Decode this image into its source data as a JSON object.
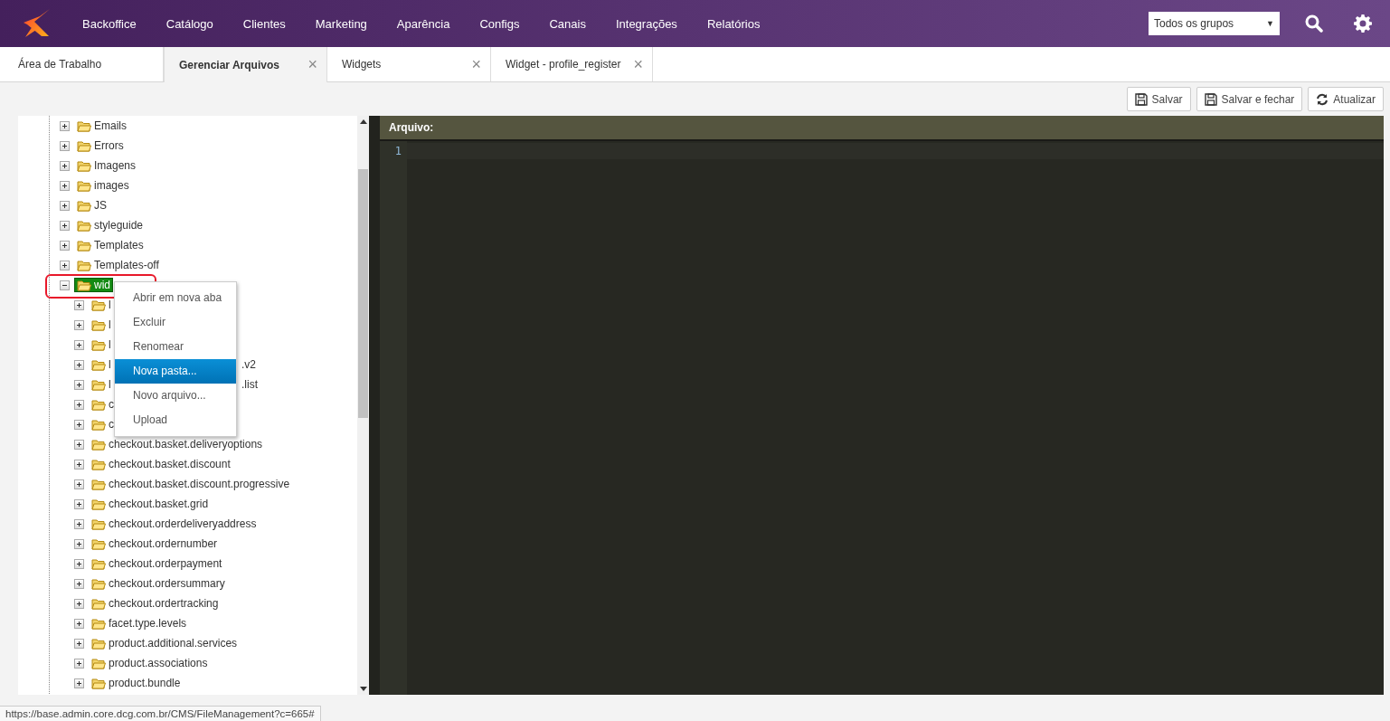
{
  "nav": {
    "items": [
      "Backoffice",
      "Catálogo",
      "Clientes",
      "Marketing",
      "Aparência",
      "Configs",
      "Canais",
      "Integrações",
      "Relatórios"
    ],
    "group_select": {
      "value": "Todos os grupos",
      "caret": "▼"
    }
  },
  "tabs": [
    {
      "label": "Área de Trabalho",
      "selected": false,
      "closable": false
    },
    {
      "label": "Gerenciar Arquivos",
      "selected": true,
      "closable": true
    },
    {
      "label": "Widgets",
      "selected": false,
      "closable": true
    },
    {
      "label": "Widget - profile_register",
      "selected": false,
      "closable": true
    }
  ],
  "close_glyph": "×",
  "toolbar": [
    {
      "label": "Salvar",
      "kind": "save"
    },
    {
      "label": "Salvar e fechar",
      "kind": "save"
    },
    {
      "label": "Atualizar",
      "kind": "refresh"
    }
  ],
  "tree": [
    {
      "label": "Emails",
      "selected": false,
      "expanded": false
    },
    {
      "label": "Errors",
      "selected": false,
      "expanded": false
    },
    {
      "label": "Imagens",
      "selected": false,
      "expanded": false
    },
    {
      "label": "images",
      "selected": false,
      "expanded": false
    },
    {
      "label": "JS",
      "selected": false,
      "expanded": false
    },
    {
      "label": "styleguide",
      "selected": false,
      "expanded": false
    },
    {
      "label": "Templates",
      "selected": false,
      "expanded": false
    },
    {
      "label": "Templates-off",
      "selected": false,
      "expanded": false
    },
    {
      "label": "wid",
      "selected": true,
      "expanded": true,
      "children": [
        {
          "label": "l",
          "selected": false,
          "expanded": false
        },
        {
          "label": "l",
          "selected": false,
          "expanded": false
        },
        {
          "label": "l",
          "selected": false,
          "expanded": false
        },
        {
          "label": "l",
          "tail": ".v2",
          "selected": false,
          "expanded": false
        },
        {
          "label": "l",
          "tail": ".list",
          "selected": false,
          "expanded": false
        },
        {
          "label": "c",
          "selected": false,
          "expanded": false
        },
        {
          "label": "c",
          "selected": false,
          "expanded": false
        },
        {
          "label": "checkout.basket.deliveryoptions",
          "selected": false,
          "expanded": false
        },
        {
          "label": "checkout.basket.discount",
          "selected": false,
          "expanded": false
        },
        {
          "label": "checkout.basket.discount.progressive",
          "selected": false,
          "expanded": false
        },
        {
          "label": "checkout.basket.grid",
          "selected": false,
          "expanded": false
        },
        {
          "label": "checkout.orderdeliveryaddress",
          "selected": false,
          "expanded": false
        },
        {
          "label": "checkout.ordernumber",
          "selected": false,
          "expanded": false
        },
        {
          "label": "checkout.orderpayment",
          "selected": false,
          "expanded": false
        },
        {
          "label": "checkout.ordersummary",
          "selected": false,
          "expanded": false
        },
        {
          "label": "checkout.ordertracking",
          "selected": false,
          "expanded": false
        },
        {
          "label": "facet.type.levels",
          "selected": false,
          "expanded": false
        },
        {
          "label": "product.additional.services",
          "selected": false,
          "expanded": false
        },
        {
          "label": "product.associations",
          "selected": false,
          "expanded": false
        },
        {
          "label": "product.bundle",
          "selected": false,
          "expanded": false
        }
      ]
    }
  ],
  "context_menu": [
    {
      "label": "Abrir em nova aba",
      "selected": false
    },
    {
      "label": "Excluir",
      "selected": false
    },
    {
      "label": "Renomear",
      "selected": false
    },
    {
      "label": "Nova pasta...",
      "selected": true
    },
    {
      "label": "Novo arquivo...",
      "selected": false
    },
    {
      "label": "Upload",
      "selected": false
    }
  ],
  "editor": {
    "header": "Arquivo:",
    "line_numbers": [
      "1"
    ]
  },
  "status_url": "https://base.admin.core.dcg.com.br/CMS/FileManagement?c=665#"
}
